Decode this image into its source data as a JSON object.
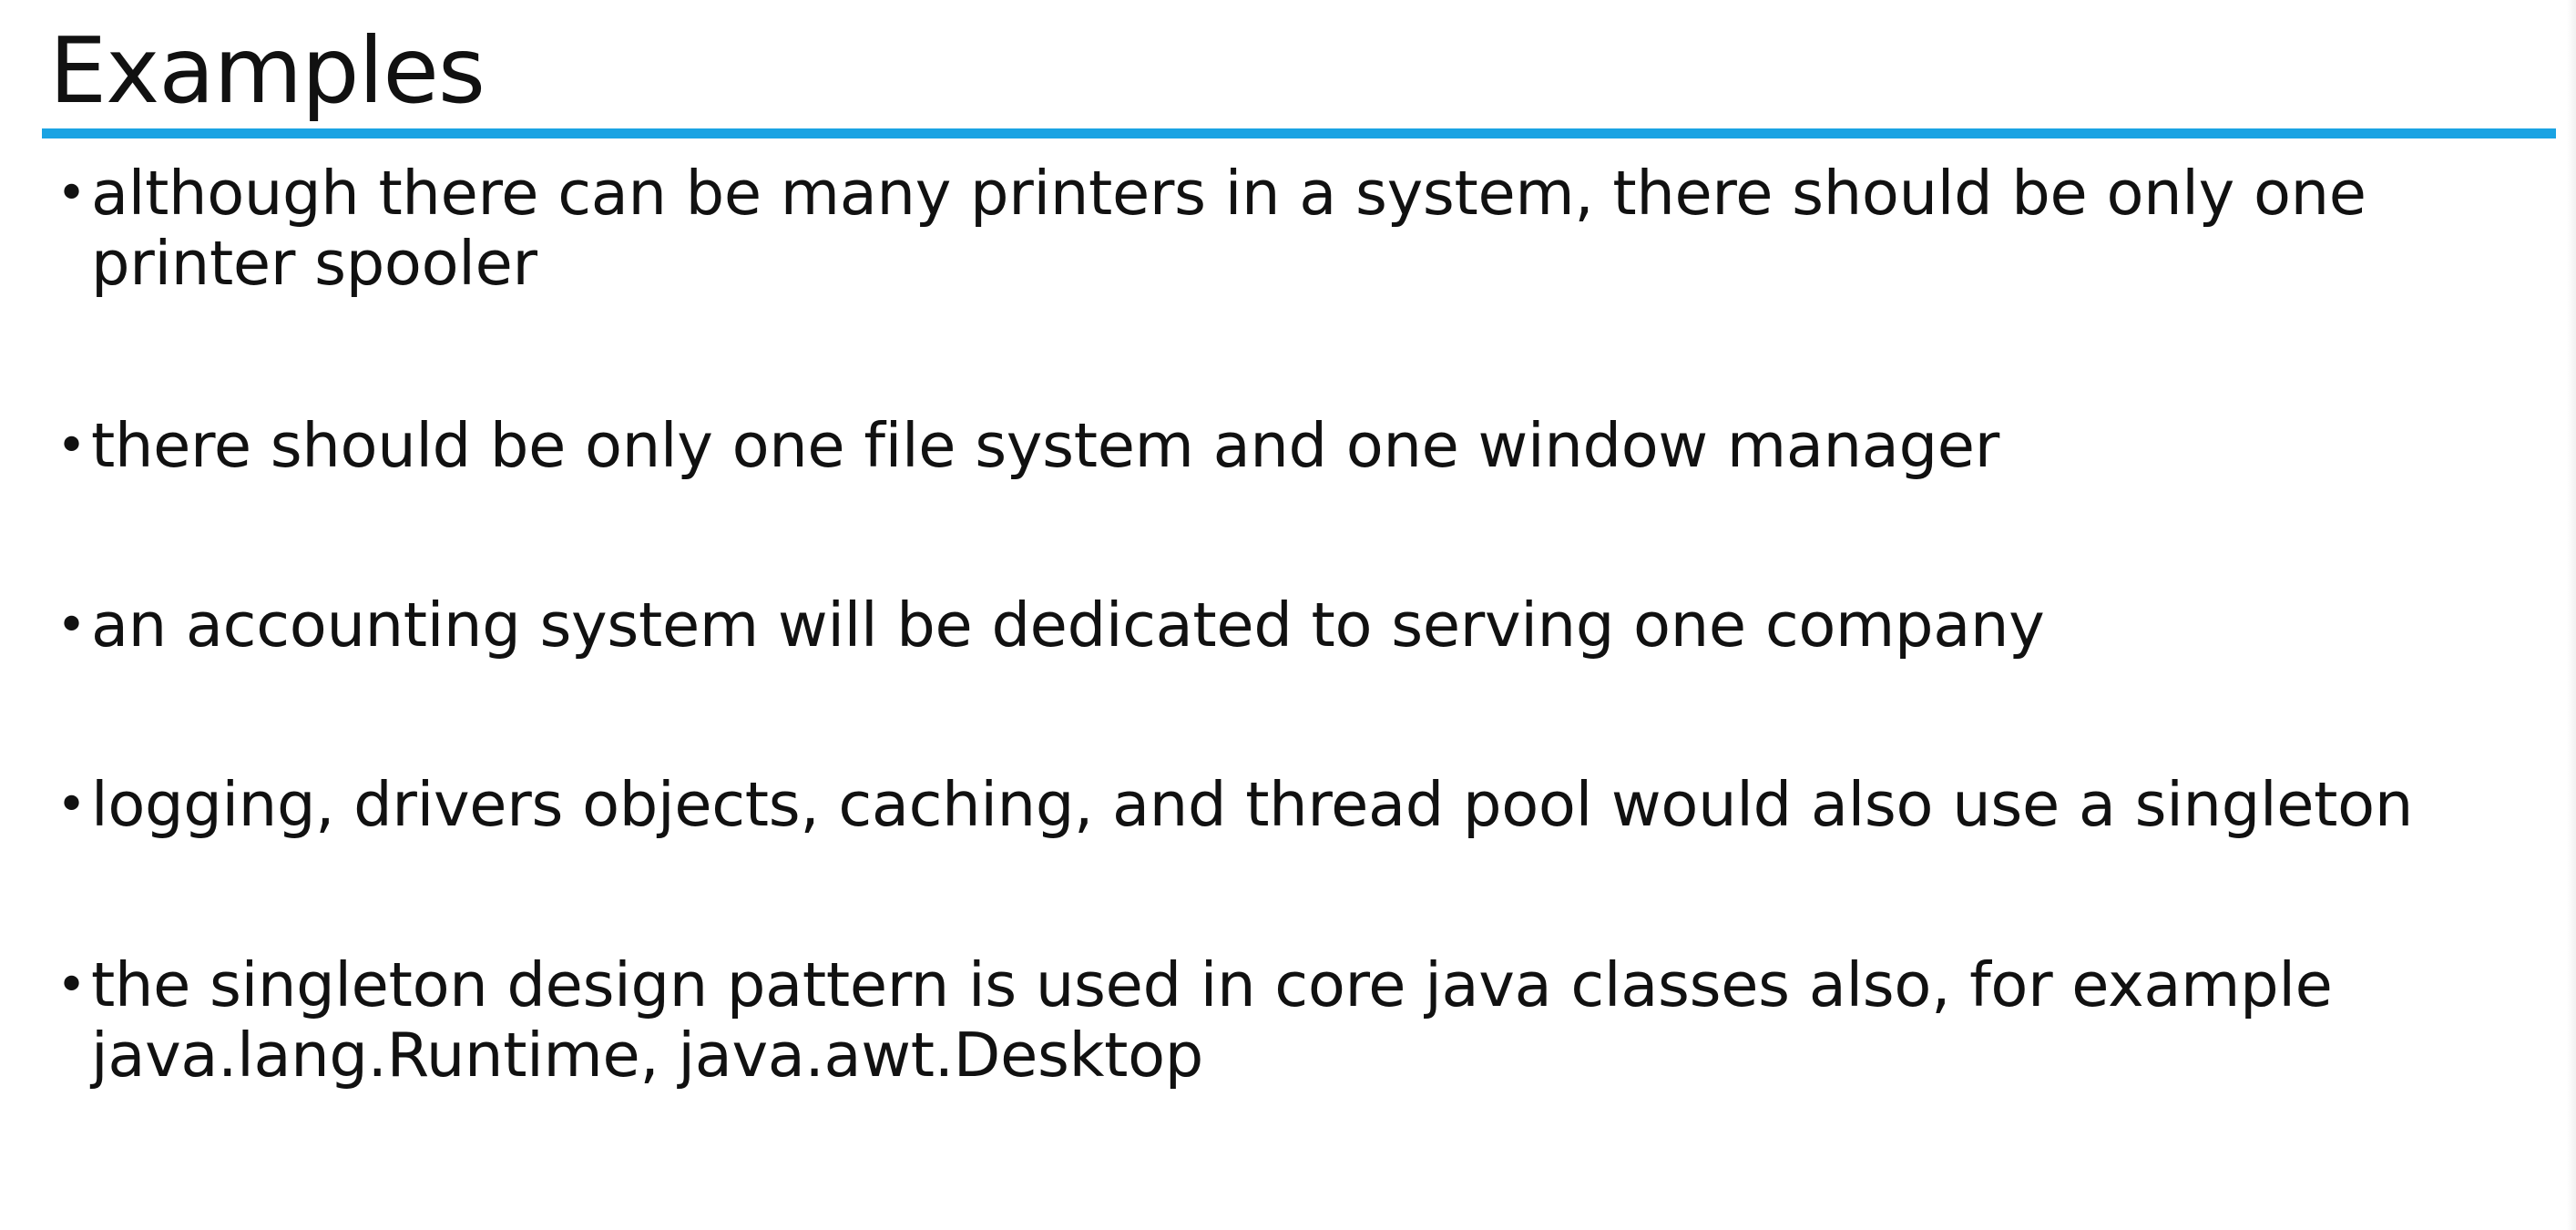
{
  "slide": {
    "title": "Examples",
    "accent_color": "#1aa3e3",
    "bullet_symbol": "•",
    "bullets": [
      {
        "line1": "although there can be many printers in a system, there should be only one",
        "line2": "printer spooler"
      },
      {
        "line1": "there should be only one file system and one window manager",
        "line2": ""
      },
      {
        "line1": "an accounting system will be dedicated to serving one company",
        "line2": ""
      },
      {
        "line1": "logging, drivers objects, caching, and thread pool would also use a singleton",
        "line2": ""
      },
      {
        "line1": "the singleton design pattern is used in core java classes also, for example",
        "line2": "java.lang.Runtime, java.awt.Desktop"
      }
    ]
  }
}
